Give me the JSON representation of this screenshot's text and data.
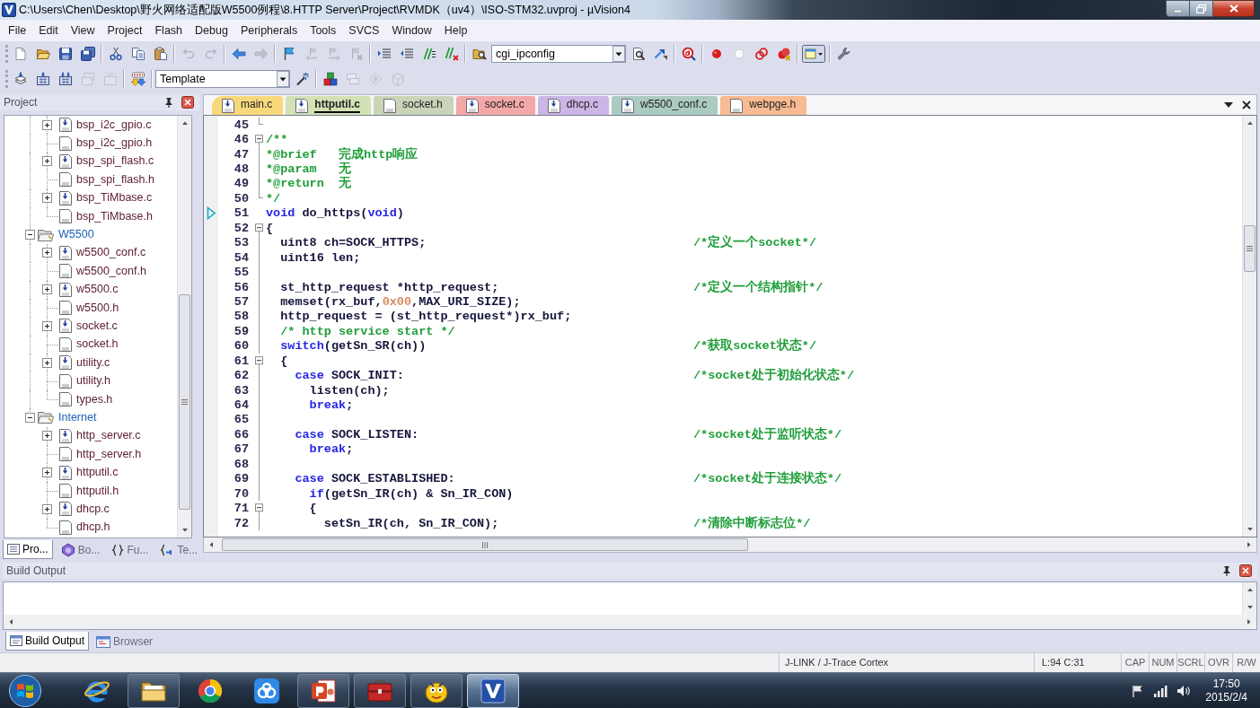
{
  "window": {
    "title": "C:\\Users\\Chen\\Desktop\\野火网络适配版W5500例程\\8.HTTP Server\\Project\\RVMDK（uv4）\\ISO-STM32.uvproj - µVision4"
  },
  "menu": [
    "File",
    "Edit",
    "View",
    "Project",
    "Flash",
    "Debug",
    "Peripherals",
    "Tools",
    "SVCS",
    "Window",
    "Help"
  ],
  "toolbars": [
    {
      "groups": [
        [
          {
            "kind": "new-file",
            "disabled": false
          },
          {
            "kind": "open-file",
            "disabled": false
          },
          {
            "kind": "save",
            "disabled": false
          },
          {
            "kind": "save-all",
            "disabled": false
          }
        ],
        [
          {
            "kind": "cut",
            "disabled": false
          },
          {
            "kind": "copy",
            "disabled": false
          },
          {
            "kind": "paste",
            "disabled": false
          }
        ],
        [
          {
            "kind": "undo",
            "disabled": true
          },
          {
            "kind": "redo",
            "disabled": true
          }
        ],
        [
          {
            "kind": "navigate-back",
            "disabled": false
          },
          {
            "kind": "navigate-forward",
            "disabled": true
          }
        ],
        [
          {
            "kind": "bookmark",
            "disabled": false
          },
          {
            "kind": "prev-bookmark",
            "disabled": true
          },
          {
            "kind": "next-bookmark",
            "disabled": true
          },
          {
            "kind": "clear-bookmarks",
            "disabled": true
          }
        ],
        [
          {
            "kind": "indent",
            "disabled": false
          },
          {
            "kind": "unindent",
            "disabled": false
          },
          {
            "kind": "comment",
            "disabled": false
          },
          {
            "kind": "uncomment",
            "disabled": false
          }
        ],
        [
          {
            "kind": "find-in-files",
            "disabled": false
          },
          {
            "kind": "combo",
            "value": "cgi_ipconfig",
            "disabled": false
          },
          {
            "kind": "find",
            "disabled": false
          },
          {
            "kind": "incremental-find",
            "disabled": false
          }
        ],
        [
          {
            "kind": "debug",
            "disabled": false
          }
        ],
        [
          {
            "kind": "breakpoint",
            "disabled": false
          },
          {
            "kind": "disabled-breakpoint",
            "disabled": false
          },
          {
            "kind": "disable-breakpoints",
            "disabled": false
          },
          {
            "kind": "kill-breakpoints",
            "disabled": false
          }
        ],
        [
          {
            "kind": "window-menu",
            "disabled": false
          }
        ],
        [
          {
            "kind": "configure",
            "disabled": false
          }
        ]
      ]
    },
    {
      "groups": [
        [
          {
            "kind": "translate",
            "disabled": false
          },
          {
            "kind": "build",
            "disabled": false
          },
          {
            "kind": "rebuild",
            "disabled": false
          },
          {
            "kind": "batch-build",
            "disabled": true
          },
          {
            "kind": "stop-build",
            "disabled": true
          }
        ],
        [
          {
            "kind": "download",
            "disabled": false
          }
        ],
        [
          {
            "kind": "combo",
            "value": "Template",
            "disabled": false
          },
          {
            "kind": "target-options",
            "disabled": false
          }
        ],
        [
          {
            "kind": "manage-components",
            "disabled": false
          },
          {
            "kind": "multi-project",
            "disabled": true
          },
          {
            "kind": "select-packs",
            "disabled": true
          },
          {
            "kind": "pack-installer",
            "disabled": true
          }
        ]
      ]
    }
  ],
  "project_panel": {
    "title": "Project",
    "tree": [
      {
        "children": [
          {
            "label": "bsp_i2c_gpio.c",
            "kind": "source",
            "expanded": false
          },
          {
            "label": "bsp_i2c_gpio.h",
            "kind": "header"
          },
          {
            "label": "bsp_spi_flash.c",
            "kind": "source",
            "expanded": false
          },
          {
            "label": "bsp_spi_flash.h",
            "kind": "header"
          },
          {
            "label": "bsp_TiMbase.c",
            "kind": "source",
            "expanded": false
          },
          {
            "label": "bsp_TiMbase.h",
            "kind": "header"
          }
        ]
      },
      {
        "label": "W5500",
        "kind": "group",
        "expanded": true,
        "children": [
          {
            "label": "w5500_conf.c",
            "kind": "source",
            "expanded": false
          },
          {
            "label": "w5500_conf.h",
            "kind": "header"
          },
          {
            "label": "w5500.c",
            "kind": "source",
            "expanded": false
          },
          {
            "label": "w5500.h",
            "kind": "header"
          },
          {
            "label": "socket.c",
            "kind": "source",
            "expanded": false
          },
          {
            "label": "socket.h",
            "kind": "header"
          },
          {
            "label": "utility.c",
            "kind": "source",
            "expanded": false
          },
          {
            "label": "utility.h",
            "kind": "header"
          },
          {
            "label": "types.h",
            "kind": "header"
          }
        ]
      },
      {
        "label": "Internet",
        "kind": "group",
        "expanded": true,
        "children": [
          {
            "label": "http_server.c",
            "kind": "source",
            "expanded": false
          },
          {
            "label": "http_server.h",
            "kind": "header"
          },
          {
            "label": "httputil.c",
            "kind": "source",
            "expanded": false
          },
          {
            "label": "httputil.h",
            "kind": "header"
          },
          {
            "label": "dhcp.c",
            "kind": "source",
            "expanded": false
          },
          {
            "label": "dhcp.h",
            "kind": "header"
          }
        ]
      }
    ],
    "tabs": [
      {
        "label": "Pro...",
        "kind": "project",
        "selected": true
      },
      {
        "label": "Bo...",
        "kind": "books",
        "selected": false
      },
      {
        "label": "Fu...",
        "kind": "functions",
        "selected": false
      },
      {
        "label": "Te...",
        "kind": "templates",
        "selected": false
      }
    ]
  },
  "editor": {
    "tabs": [
      {
        "label": "main.c",
        "kind": "source",
        "color": "#f7d97c",
        "selected": false
      },
      {
        "label": "httputil.c",
        "kind": "source",
        "color": "#d2e2b4",
        "selected": true
      },
      {
        "label": "socket.h",
        "kind": "header",
        "color": "#c9d4b9",
        "selected": false
      },
      {
        "label": "socket.c",
        "kind": "source",
        "color": "#f3a8a8",
        "selected": false
      },
      {
        "label": "dhcp.c",
        "kind": "source",
        "color": "#cbb6e6",
        "selected": false
      },
      {
        "label": "w5500_conf.c",
        "kind": "source",
        "color": "#abcac2",
        "selected": false
      },
      {
        "label": "webpge.h",
        "kind": "header",
        "color": "#f8bb92",
        "selected": false
      }
    ],
    "lines": [
      {
        "number": "45",
        "kind": "fold-end",
        "current": false
      },
      {
        "number": "46",
        "kind": "fold-start",
        "current": false,
        "tokens": [
          {
            "kind": "comment",
            "text": "/**"
          }
        ]
      },
      {
        "number": "47",
        "kind": "fold-body",
        "current": false,
        "tokens": [
          {
            "kind": "comment",
            "text": "*@brief   完成http响应"
          }
        ]
      },
      {
        "number": "48",
        "kind": "fold-body",
        "current": false,
        "tokens": [
          {
            "kind": "comment",
            "text": "*@param   无"
          }
        ]
      },
      {
        "number": "49",
        "kind": "fold-body",
        "current": false,
        "tokens": [
          {
            "kind": "comment",
            "text": "*@return  无"
          }
        ]
      },
      {
        "number": "50",
        "kind": "fold-end",
        "current": false,
        "tokens": [
          {
            "kind": "comment",
            "text": "*/"
          }
        ]
      },
      {
        "number": "51",
        "kind": "plain",
        "current": true,
        "tokens": [
          {
            "kind": "keyword",
            "text": "void"
          },
          {
            "kind": "plain",
            "text": " do_https("
          },
          {
            "kind": "keyword",
            "text": "void"
          },
          {
            "kind": "plain",
            "text": ")"
          }
        ]
      },
      {
        "number": "52",
        "kind": "fold-start",
        "current": false,
        "tokens": [
          {
            "kind": "plain",
            "text": "{"
          }
        ]
      },
      {
        "number": "53",
        "kind": "fold-body",
        "current": false,
        "tokens": [
          {
            "kind": "plain",
            "text": "  uint8 ch=SOCK_HTTPS;"
          }
        ],
        "note": "/*定义一个socket*/"
      },
      {
        "number": "54",
        "kind": "fold-body",
        "current": false,
        "tokens": [
          {
            "kind": "plain",
            "text": "  uint16 len;"
          }
        ]
      },
      {
        "number": "55",
        "kind": "fold-body",
        "current": false
      },
      {
        "number": "56",
        "kind": "fold-body",
        "current": false,
        "tokens": [
          {
            "kind": "plain",
            "text": "  st_http_request *http_request;"
          }
        ],
        "note": "/*定义一个结构指针*/"
      },
      {
        "number": "57",
        "kind": "fold-body",
        "current": false,
        "tokens": [
          {
            "kind": "plain",
            "text": "  memset(rx_buf,"
          },
          {
            "kind": "number",
            "text": "0x00"
          },
          {
            "kind": "plain",
            "text": ",MAX_URI_SIZE);"
          }
        ]
      },
      {
        "number": "58",
        "kind": "fold-body",
        "current": false,
        "tokens": [
          {
            "kind": "plain",
            "text": "  http_request = (st_http_request*)rx_buf;"
          }
        ]
      },
      {
        "number": "59",
        "kind": "fold-body",
        "current": false,
        "tokens": [
          {
            "kind": "comment",
            "text": "  /* http service start */"
          }
        ]
      },
      {
        "number": "60",
        "kind": "fold-body",
        "current": false,
        "tokens": [
          {
            "kind": "keyword",
            "text": "  switch"
          },
          {
            "kind": "plain",
            "text": "(getSn_SR(ch))"
          }
        ],
        "note": "/*获取socket状态*/"
      },
      {
        "number": "61",
        "kind": "fold-start",
        "current": false,
        "tokens": [
          {
            "kind": "plain",
            "text": "  {"
          }
        ]
      },
      {
        "number": "62",
        "kind": "fold-body",
        "current": false,
        "tokens": [
          {
            "kind": "keyword",
            "text": "    case"
          },
          {
            "kind": "plain",
            "text": " SOCK_INIT:"
          }
        ],
        "note": "/*socket处于初始化状态*/"
      },
      {
        "number": "63",
        "kind": "fold-body",
        "current": false,
        "tokens": [
          {
            "kind": "plain",
            "text": "      listen(ch);"
          }
        ]
      },
      {
        "number": "64",
        "kind": "fold-body",
        "current": false,
        "tokens": [
          {
            "kind": "keyword",
            "text": "      break"
          },
          {
            "kind": "plain",
            "text": ";"
          }
        ]
      },
      {
        "number": "65",
        "kind": "fold-body",
        "current": false
      },
      {
        "number": "66",
        "kind": "fold-body",
        "current": false,
        "tokens": [
          {
            "kind": "keyword",
            "text": "    case"
          },
          {
            "kind": "plain",
            "text": " SOCK_LISTEN:"
          }
        ],
        "note": "/*socket处于监听状态*/"
      },
      {
        "number": "67",
        "kind": "fold-body",
        "current": false,
        "tokens": [
          {
            "kind": "keyword",
            "text": "      break"
          },
          {
            "kind": "plain",
            "text": ";"
          }
        ]
      },
      {
        "number": "68",
        "kind": "fold-body",
        "current": false
      },
      {
        "number": "69",
        "kind": "fold-body",
        "current": false,
        "tokens": [
          {
            "kind": "keyword",
            "text": "    case"
          },
          {
            "kind": "plain",
            "text": " SOCK_ESTABLISHED:"
          }
        ],
        "note": "/*socket处于连接状态*/"
      },
      {
        "number": "70",
        "kind": "fold-body",
        "current": false,
        "tokens": [
          {
            "kind": "keyword",
            "text": "      if"
          },
          {
            "kind": "plain",
            "text": "(getSn_IR(ch) & Sn_IR_CON)"
          }
        ]
      },
      {
        "number": "71",
        "kind": "fold-start",
        "current": false,
        "tokens": [
          {
            "kind": "plain",
            "text": "      {"
          }
        ]
      },
      {
        "number": "72",
        "kind": "fold-body",
        "current": false,
        "tokens": [
          {
            "kind": "plain",
            "text": "        setSn_IR(ch, Sn_IR_CON);"
          }
        ],
        "note": "/*清除中断标志位*/"
      }
    ]
  },
  "build_output": {
    "title": "Build Output",
    "tabs": [
      {
        "label": "Build Output",
        "kind": "output",
        "selected": true
      },
      {
        "label": "Browser",
        "kind": "browser",
        "selected": false
      }
    ]
  },
  "status_bar": {
    "target": "J-LINK / J-Trace Cortex",
    "cursor": "L:94 C:31",
    "keys": [
      "CAP",
      "NUM",
      "SCRL",
      "OVR",
      "R/W"
    ]
  },
  "taskbar": {
    "apps": [
      {
        "kind": "web-browser",
        "running": false,
        "selected": false
      },
      {
        "kind": "file-manager",
        "running": true,
        "selected": false
      },
      {
        "kind": "ring-browser",
        "running": false,
        "selected": false
      },
      {
        "kind": "cloud",
        "running": false,
        "selected": false
      },
      {
        "kind": "presentation",
        "running": true,
        "selected": false
      },
      {
        "kind": "toolbox",
        "running": true,
        "selected": false
      },
      {
        "kind": "mascot",
        "running": true,
        "selected": false
      },
      {
        "kind": "ide",
        "running": true,
        "selected": true
      }
    ],
    "time": "17:50",
    "date": "2015/2/4"
  }
}
